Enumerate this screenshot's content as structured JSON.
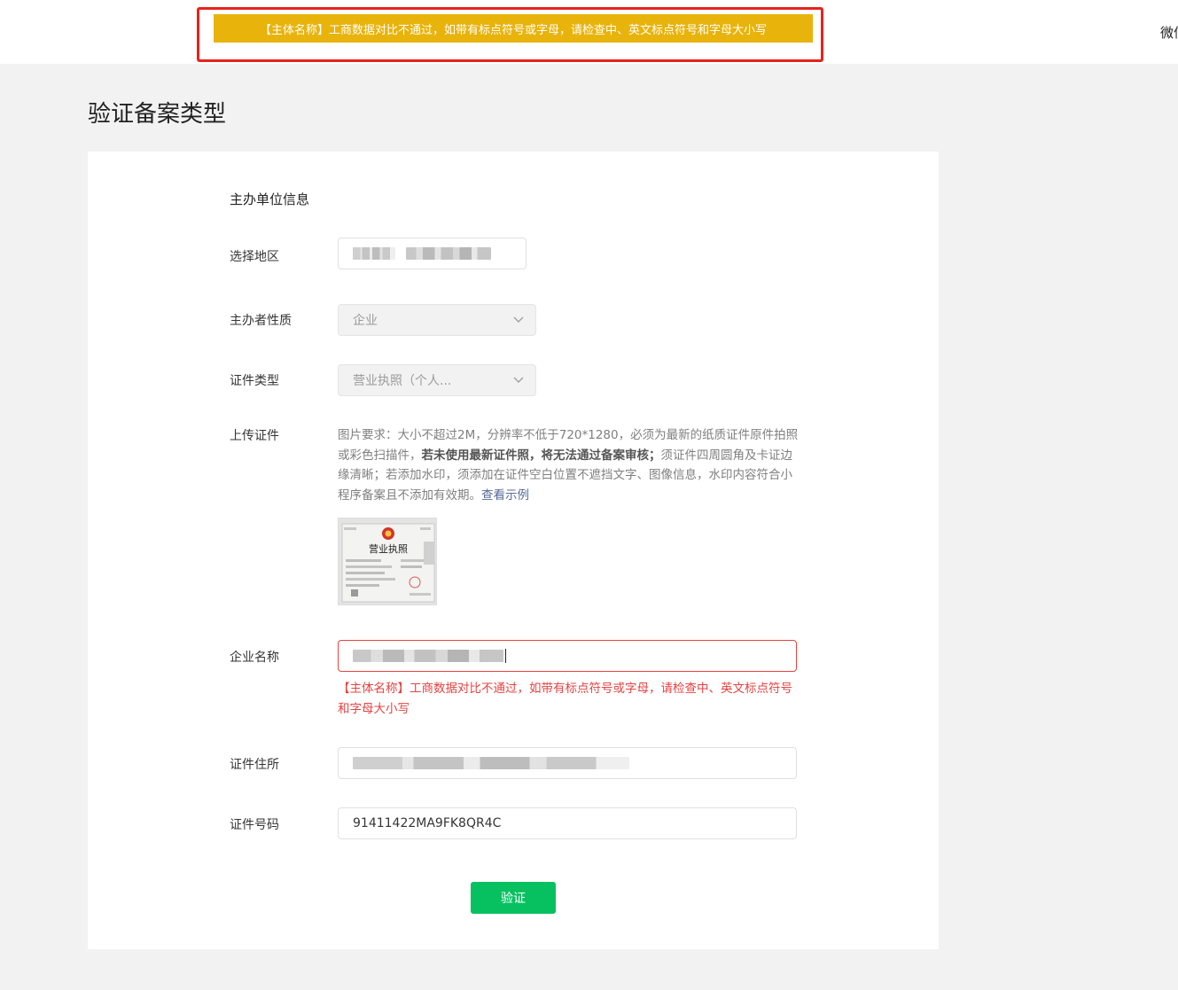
{
  "toast": {
    "message": "【主体名称】工商数据对比不通过，如带有标点符号或字母，请检查中、英文标点符号和字母大小写"
  },
  "header": {
    "right_text": "微信"
  },
  "page": {
    "title": "验证备案类型"
  },
  "form": {
    "section_title": "主办单位信息",
    "region": {
      "label": "选择地区"
    },
    "organizer_type": {
      "label": "主办者性质",
      "value": "企业"
    },
    "cert_type": {
      "label": "证件类型",
      "value": "营业执照（个人..."
    },
    "upload": {
      "label": "上传证件",
      "req_part1": "图片要求：大小不超过2M，分辨率不低于720*1280，必须为最新的纸质证件原件拍照或彩色扫描件，",
      "req_bold": "若未使用最新证件照，将无法通过备案审核；",
      "req_part2": "须证件四周圆角及卡证边缘清晰；若添加水印，须添加在证件空白位置不遮挡文字、图像信息，水印内容符合小程序备案且不添加有效期。",
      "example_link": "查看示例",
      "thumbnail_text": "营业执照"
    },
    "company_name": {
      "label": "企业名称",
      "error": "【主体名称】工商数据对比不通过，如带有标点符号或字母，请检查中、英文标点符号和字母大小写"
    },
    "cert_address": {
      "label": "证件住所"
    },
    "cert_number": {
      "label": "证件号码",
      "value": "91411422MA9FK8QR4C"
    },
    "submit_label": "验证"
  },
  "colors": {
    "toast_bg": "#e8b30b",
    "highlight_outline": "#e8221c",
    "error": "#e64340",
    "primary_button": "#07c160",
    "link": "#576b95"
  }
}
